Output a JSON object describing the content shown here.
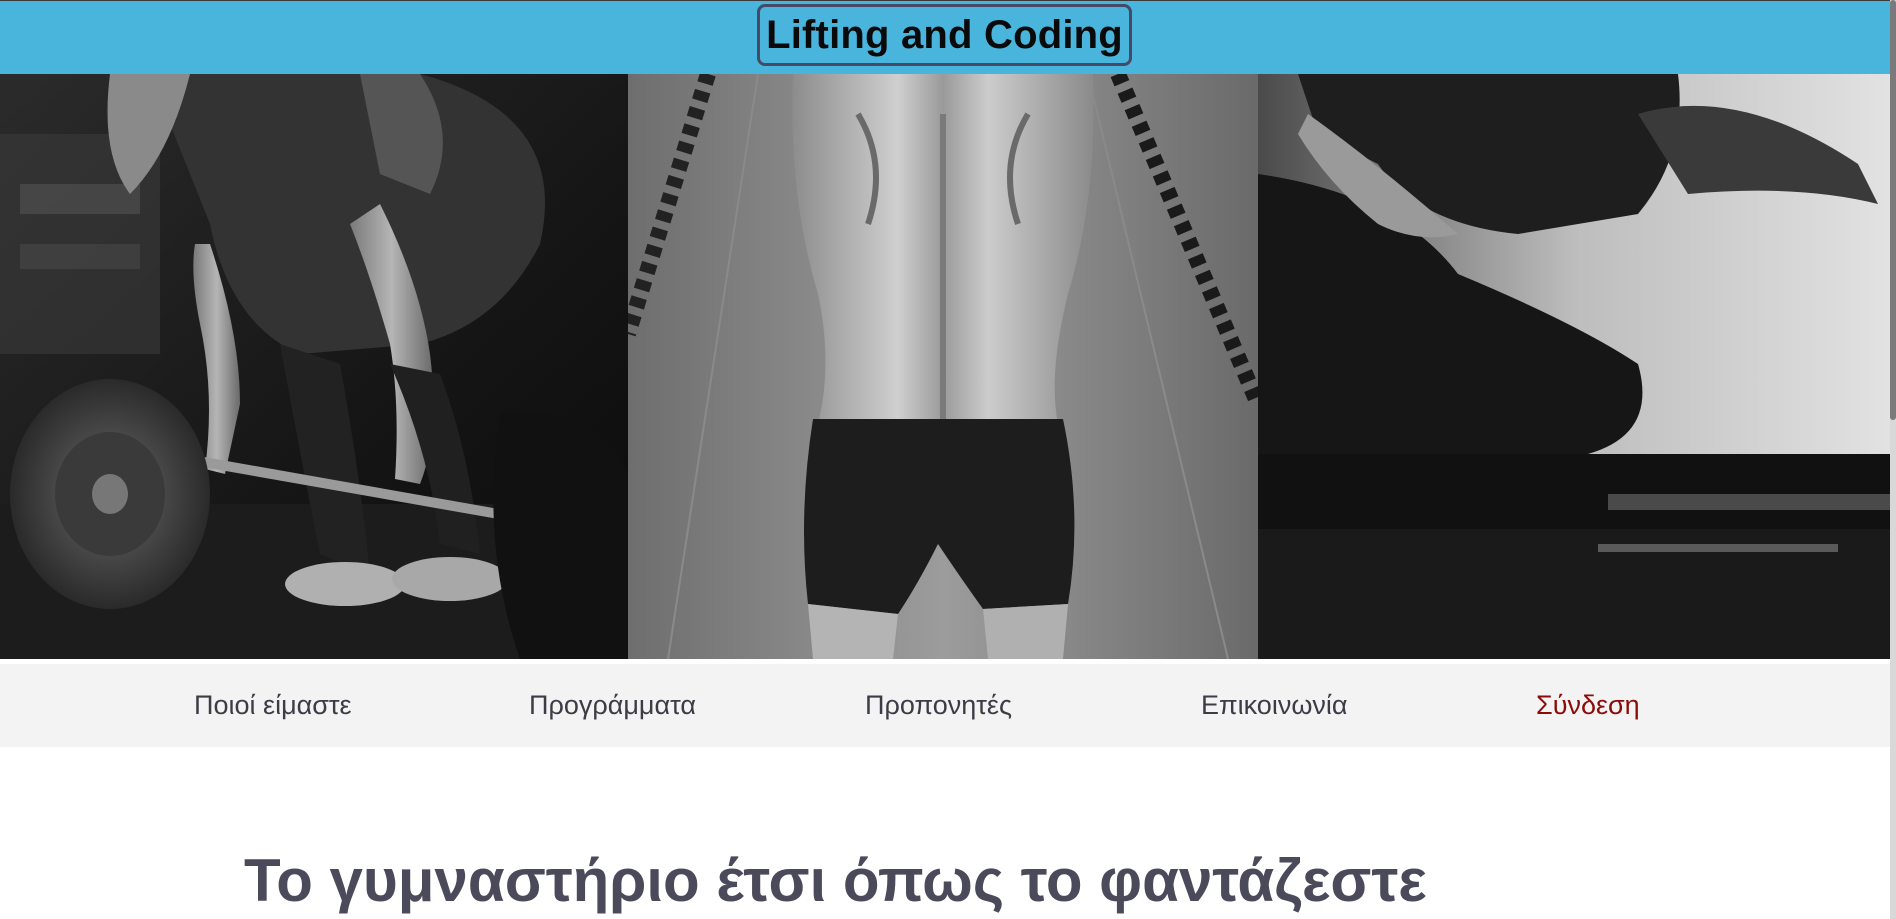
{
  "header": {
    "site_title": "Lifting and Coding",
    "background_color": "#49b5dd"
  },
  "hero": {
    "photos": [
      {
        "subject": "deadlift-photo"
      },
      {
        "subject": "back-muscles-photo"
      },
      {
        "subject": "pilates-reformer-photo"
      }
    ]
  },
  "nav": {
    "items": [
      {
        "label": "Ποιοί είμαστε"
      },
      {
        "label": "Προγράμματα"
      },
      {
        "label": "Προπονητές"
      },
      {
        "label": "Επικοινωνία"
      },
      {
        "label": "Σύνδεση",
        "color": "#8c0b0b"
      }
    ]
  },
  "main": {
    "heading": "Το γυμναστήριο έτσι όπως το φαντάζεστε"
  }
}
